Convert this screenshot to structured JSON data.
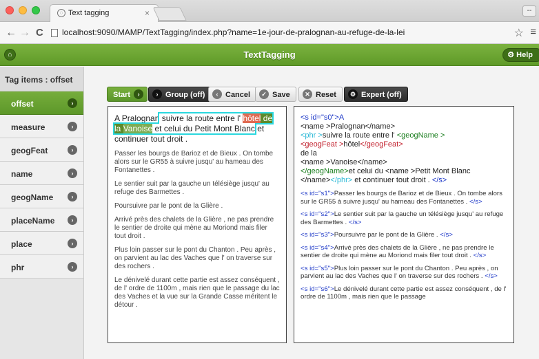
{
  "browser": {
    "tab_title": "Text tagging",
    "tab_close": "×",
    "url": "localhost:9090/MAMP/TextTagging/index.php?name=1e-jour-de-pralognan-au-refuge-de-la-lei",
    "win_btn": "--",
    "nav": {
      "back": "←",
      "forward": "→",
      "reload": "C",
      "star": "☆",
      "menu": "≡"
    }
  },
  "app": {
    "title": "TextTagging",
    "help_label": "Help",
    "home_icon": "home-icon",
    "accent_color": "#6aa533"
  },
  "sidebar": {
    "heading": "Tag items : offset",
    "items": [
      {
        "label": "offset",
        "active": true
      },
      {
        "label": "measure",
        "active": false
      },
      {
        "label": "geogFeat",
        "active": false
      },
      {
        "label": "name",
        "active": false
      },
      {
        "label": "geogName",
        "active": false
      },
      {
        "label": "placeName",
        "active": false
      },
      {
        "label": "place",
        "active": false
      },
      {
        "label": "phr",
        "active": false
      }
    ]
  },
  "toolbar": {
    "start": "Start",
    "group": "Group (off)",
    "cancel": "Cancel",
    "save": "Save",
    "reset": "Reset",
    "expert": "Expert (off)"
  },
  "text_panel": {
    "first_sentence": {
      "a": "A ",
      "pralognan": "Pralognan",
      "mid1": " suivre la route entre l' ",
      "hotel": "hôtel",
      "sp": " ",
      "dela": "de la",
      "sp2": " ",
      "vanoise": "Vanoise",
      "rest": " et celui du Petit Mont Blanc",
      "end": " et continuer tout droit ."
    },
    "paragraphs": [
      "Passer les bourgs de Barioz et de Bieux . On tombe alors sur le GR55 à suivre jusqu' au hameau des Fontanettes .",
      "Le sentier suit par la gauche un télésiège jusqu' au refuge des Barmettes .",
      "Poursuivre par le pont de la Glière .",
      "Arrivé près des chalets de la Glière , ne pas prendre le sentier de droite qui mène au Moriond mais filer tout droit .",
      "Plus loin passer sur le pont du Chanton . Peu après , on parvient au lac des Vaches que l' on traverse sur des rochers .",
      "Le dénivelé durant cette partie est assez conséquent , de l' ordre de 1100m , mais rien que le passage du lac des Vaches et la vue sur la Grande Casse méritent le détour ."
    ]
  },
  "xml_panel": {
    "s0": {
      "open": "<s id=\"s0\">A",
      "name_open": "<name >",
      "name_val": "Pralognan",
      "name_close": "</name>",
      "phr_open": "<phr >",
      "phr_text": "suivre la route entre l' ",
      "geogName_open": "<geogName >",
      "geogFeat_open": "<geogFeat >",
      "geogFeat_val": "hôtel",
      "geogFeat_close": "</geogFeat>",
      "dela": "de la",
      "name2_open": "<name >",
      "name2_val": "Vanoise",
      "name2_close": "</name>",
      "geogName_close": "</geogName>",
      "et_celui": "et celui du ",
      "name3_open": "<name >",
      "name3_val": "Petit Mont Blanc",
      "name3_close": "</name>",
      "phr_close": "</phr>",
      "tail": " et continuer tout droit . ",
      "s_close": "</s>"
    },
    "sentences": [
      {
        "open": "<s id=\"s1\">",
        "text": "Passer les bourgs de Barioz et de Bieux . On tombe alors sur le GR55 à suivre jusqu' au hameau des Fontanettes . ",
        "close": "</s>"
      },
      {
        "open": "<s id=\"s2\">",
        "text": "Le sentier suit par la gauche un télésiège jusqu' au refuge des Barmettes . ",
        "close": "</s>"
      },
      {
        "open": "<s id=\"s3\">",
        "text": "Poursuivre par le pont de la Glière . ",
        "close": "</s>"
      },
      {
        "open": "<s id=\"s4\">",
        "text": "Arrivé près des chalets de la Glière , ne pas prendre le sentier de droite qui mène au Moriond mais filer tout droit . ",
        "close": "</s>"
      },
      {
        "open": "<s id=\"s5\">",
        "text": "Plus loin passer sur le pont du Chanton . Peu après , on parvient au lac des Vaches que l' on traverse sur des rochers . ",
        "close": "</s>"
      },
      {
        "open": "<s id=\"s6\">",
        "text": "Le dénivelé durant cette partie est assez conséquent , de l' ordre de 1100m , mais rien que le passage",
        "close": ""
      }
    ]
  }
}
